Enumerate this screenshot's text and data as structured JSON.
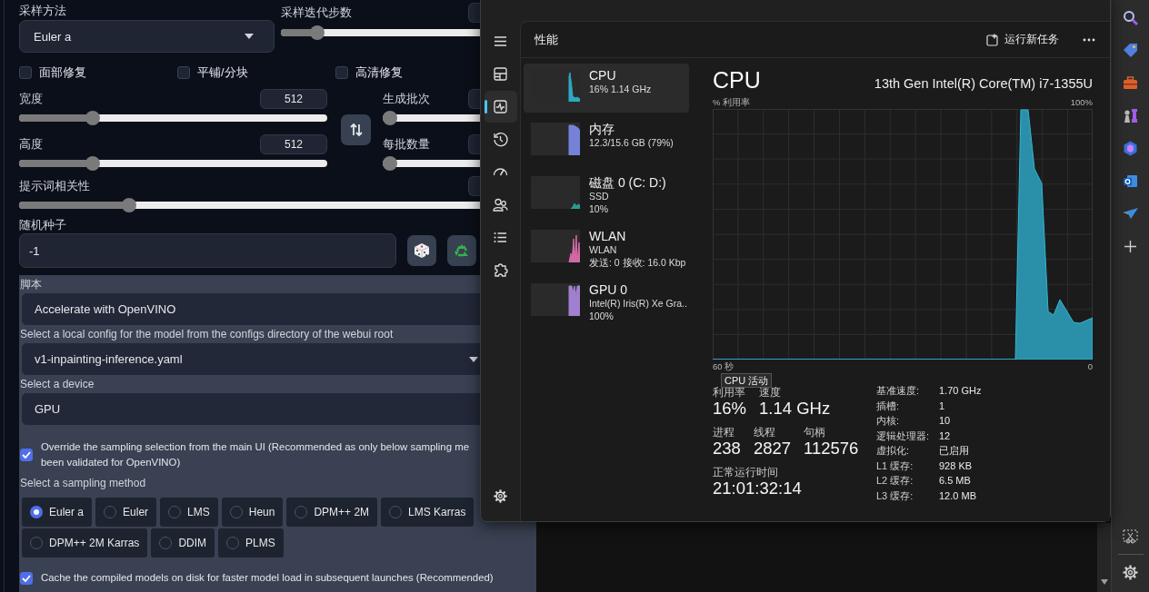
{
  "webui": {
    "sampler": {
      "label": "采样方法",
      "value": "Euler a"
    },
    "steps": {
      "label": "采样迭代步数",
      "level": 0.155
    },
    "checkboxes": [
      {
        "label": "面部修复",
        "checked": false
      },
      {
        "label": "平铺/分块",
        "checked": false
      },
      {
        "label": "高清修复",
        "checked": false
      }
    ],
    "width": {
      "label": "宽度",
      "value": "512",
      "level": 0.226
    },
    "height": {
      "label": "高度",
      "value": "512",
      "level": 0.226
    },
    "batch_count": {
      "label": "生成批次",
      "level": 0
    },
    "batch_size": {
      "label": "每批数量",
      "level": 0
    },
    "cfg": {
      "label": "提示词相关性",
      "level": 0.228
    },
    "seed": {
      "label": "随机种子",
      "value": "-1"
    },
    "script": {
      "label": "脚本",
      "value": "Accelerate with OpenVINO"
    },
    "config": {
      "label": "Select a local config for the model from the configs directory of the webui root",
      "value": "v1-inpainting-inference.yaml"
    },
    "device": {
      "label": "Select a device",
      "value": "GPU"
    },
    "override": {
      "label": "Override the sampling selection from the main UI (Recommended as only below sampling me\nbeen validated for OpenVINO)",
      "checked": true
    },
    "sampling": {
      "label": "Select a sampling method",
      "options": [
        {
          "label": "Euler a",
          "selected": true
        },
        {
          "label": "Euler",
          "selected": false
        },
        {
          "label": "LMS",
          "selected": false
        },
        {
          "label": "Heun",
          "selected": false
        },
        {
          "label": "DPM++ 2M",
          "selected": false
        },
        {
          "label": "LMS Karras",
          "selected": false
        },
        {
          "label": "DPM++ 2M Karras",
          "selected": false
        },
        {
          "label": "DDIM",
          "selected": false
        },
        {
          "label": "PLMS",
          "selected": false
        }
      ]
    },
    "cache": {
      "label": "Cache the compiled models on disk for faster model load in subsequent launches (Recommended)",
      "checked": true
    }
  },
  "task_manager": {
    "nav": [
      {
        "kind": "menu",
        "selected": false
      },
      {
        "kind": "processes",
        "selected": false
      },
      {
        "kind": "performance",
        "selected": true
      },
      {
        "kind": "history",
        "selected": false
      },
      {
        "kind": "startup",
        "selected": false
      },
      {
        "kind": "users",
        "selected": false
      },
      {
        "kind": "details",
        "selected": false
      },
      {
        "kind": "services",
        "selected": false
      }
    ],
    "page_title": "性能",
    "run_task": "运行新任务",
    "resources": [
      {
        "name": "CPU",
        "lines": [
          "16% 1.14 GHz"
        ],
        "color": "#2ea8c0",
        "selected": true
      },
      {
        "name": "内存",
        "lines": [
          "12.3/15.6 GB (79%)"
        ],
        "color": "#7682d8",
        "selected": false
      },
      {
        "name": "磁盘 0 (C: D:)",
        "lines": [
          "SSD",
          "10%"
        ],
        "color": "#2a9d8f",
        "selected": false
      },
      {
        "name": "WLAN",
        "lines": [
          "WLAN",
          "发送: 0 接收: 16.0 Kbp"
        ],
        "color": "#d66ba8",
        "selected": false
      },
      {
        "name": "GPU 0",
        "lines": [
          "Intel(R) Iris(R) Xe Gra..",
          "100%"
        ],
        "color": "#a27fd0",
        "selected": false
      }
    ],
    "detail": {
      "title": "CPU",
      "model": "13th Gen Intel(R) Core(TM) i7-1355U",
      "y_label": "% 利用率",
      "y_max": "100%",
      "x_start": "60 秒",
      "x_end": "0",
      "tooltip": "CPU 活动",
      "big_stats": [
        {
          "label": "利用率",
          "value": "16%"
        },
        {
          "label": "速度",
          "value": "1.14 GHz"
        }
      ],
      "counts": [
        {
          "label": "进程",
          "value": "238"
        },
        {
          "label": "线程",
          "value": "2827"
        },
        {
          "label": "句柄",
          "value": "112576"
        }
      ],
      "uptime": {
        "label": "正常运行时间",
        "value": "21:01:32:14"
      },
      "specs": [
        {
          "label": "基准速度:",
          "value": "1.70 GHz"
        },
        {
          "label": "插槽:",
          "value": "1"
        },
        {
          "label": "内核:",
          "value": "10"
        },
        {
          "label": "逻辑处理器:",
          "value": "12"
        },
        {
          "label": "虚拟化:",
          "value": "已启用"
        },
        {
          "label": "L1 缓存:",
          "value": "928 KB"
        },
        {
          "label": "L2 缓存:",
          "value": "6.5 MB"
        },
        {
          "label": "L3 缓存:",
          "value": "12.0 MB"
        }
      ]
    }
  }
}
